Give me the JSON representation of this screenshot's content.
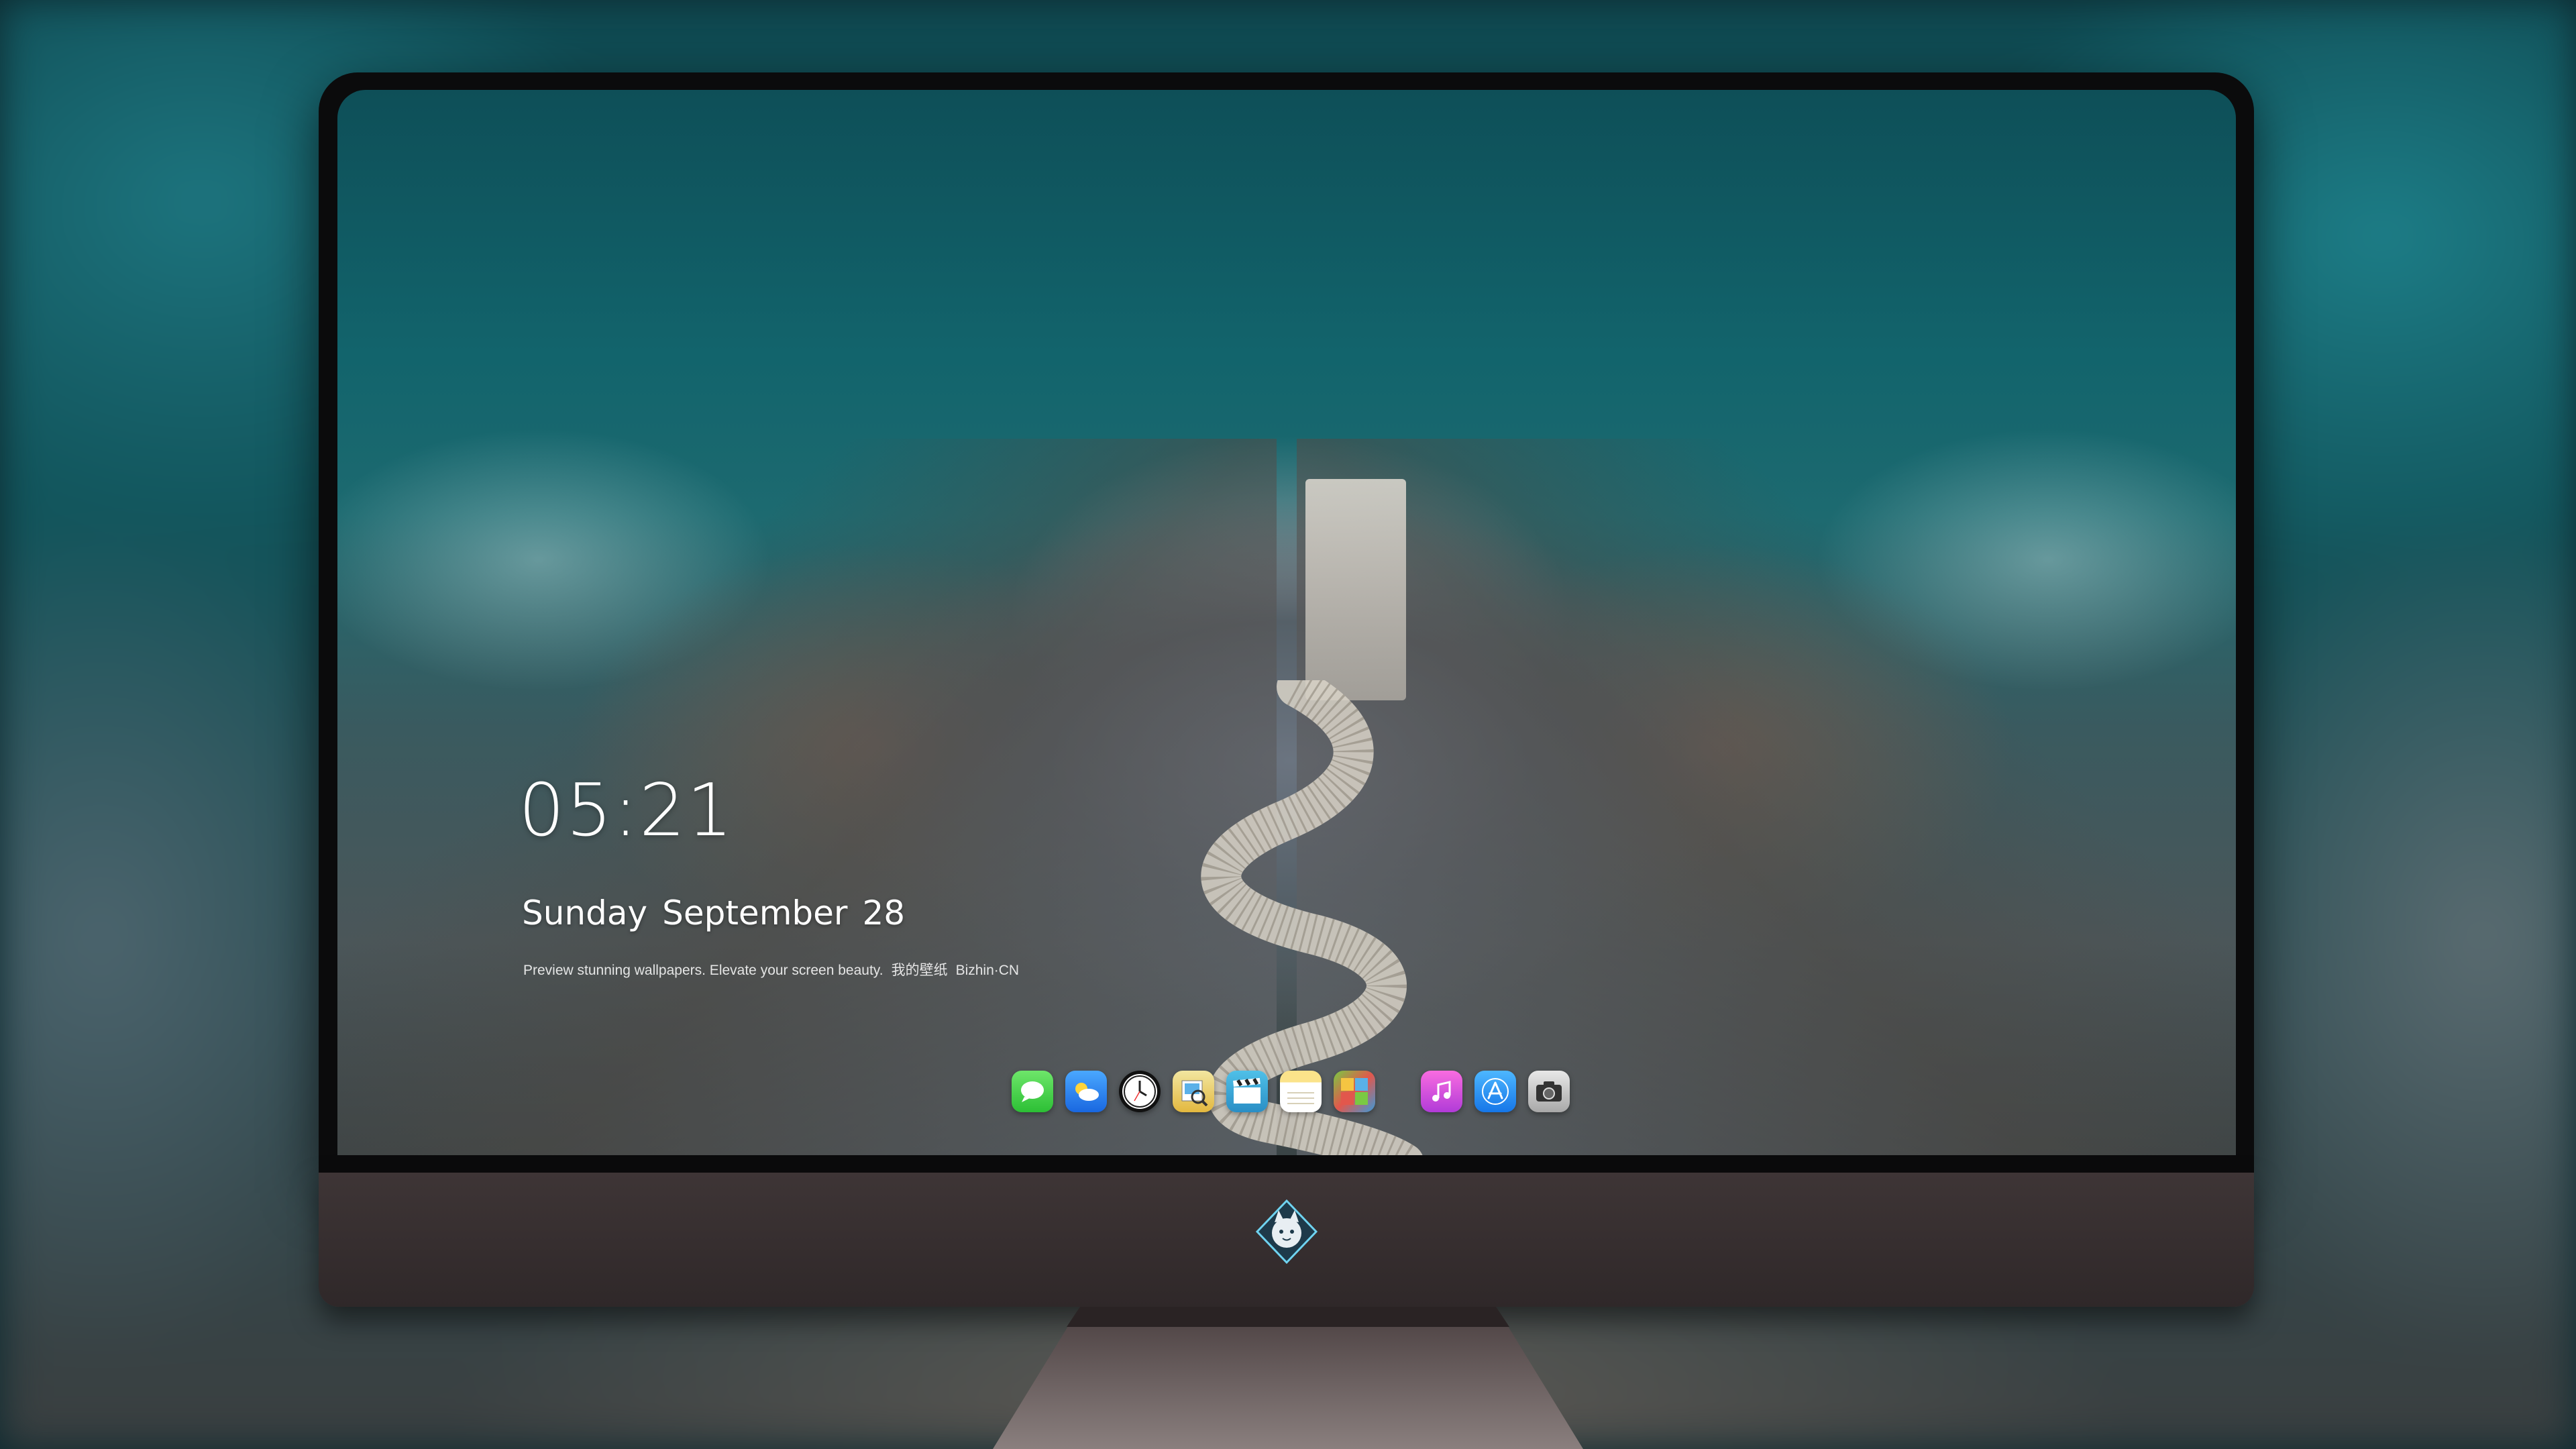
{
  "lockscreen": {
    "time": "05:21",
    "weekday": "Sunday",
    "month": "September",
    "day": "28",
    "tagline_1": "Preview stunning wallpapers. Elevate your screen beauty.",
    "tagline_2": "我的壁纸",
    "tagline_3": "Bizhin·CN"
  },
  "dock": {
    "apps": [
      {
        "name": "Messages",
        "icon": "messages-icon"
      },
      {
        "name": "Weather",
        "icon": "weather-icon"
      },
      {
        "name": "Clock",
        "icon": "clock-icon"
      },
      {
        "name": "Preview",
        "icon": "preview-icon"
      },
      {
        "name": "Claquette",
        "icon": "clapperboard-icon"
      },
      {
        "name": "Notes",
        "icon": "notes-icon"
      },
      {
        "name": "Photo Booth",
        "icon": "photo-booth-icon"
      },
      {
        "name": "Music",
        "icon": "music-icon"
      },
      {
        "name": "App Store",
        "icon": "app-store-icon"
      },
      {
        "name": "Camera",
        "icon": "camera-icon"
      }
    ]
  },
  "colors": {
    "sea": "#12646c",
    "rock": "#6b7480",
    "bezel": "#0b0b0c",
    "chin": "#3e3536"
  }
}
